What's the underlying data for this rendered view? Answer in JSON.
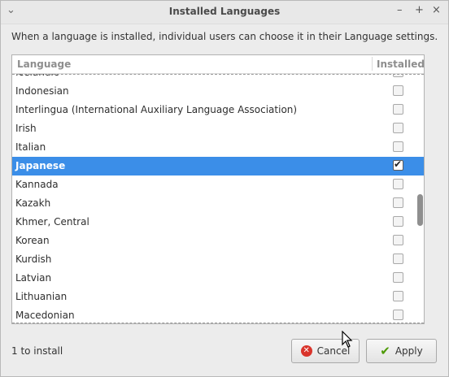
{
  "window": {
    "title": "Installed Languages",
    "description": "When a language is installed, individual users can choose it in their Language settings."
  },
  "list": {
    "header_language": "Language",
    "header_installed": "Installed",
    "rows": [
      {
        "label": "Icelandic",
        "installed": false,
        "selected": false
      },
      {
        "label": "Indonesian",
        "installed": false,
        "selected": false
      },
      {
        "label": "Interlingua (International Auxiliary Language Association)",
        "installed": false,
        "selected": false
      },
      {
        "label": "Irish",
        "installed": false,
        "selected": false
      },
      {
        "label": "Italian",
        "installed": false,
        "selected": false
      },
      {
        "label": "Japanese",
        "installed": true,
        "selected": true
      },
      {
        "label": "Kannada",
        "installed": false,
        "selected": false
      },
      {
        "label": "Kazakh",
        "installed": false,
        "selected": false
      },
      {
        "label": "Khmer, Central",
        "installed": false,
        "selected": false
      },
      {
        "label": "Korean",
        "installed": false,
        "selected": false
      },
      {
        "label": "Kurdish",
        "installed": false,
        "selected": false
      },
      {
        "label": "Latvian",
        "installed": false,
        "selected": false
      },
      {
        "label": "Lithuanian",
        "installed": false,
        "selected": false
      },
      {
        "label": "Macedonian",
        "installed": false,
        "selected": false
      }
    ]
  },
  "footer": {
    "status": "1 to install",
    "cancel_label": "Cancel",
    "apply_label": "Apply"
  },
  "titlebar_icons": {
    "menu": "window-menu-icon",
    "minimize": "minimize-icon",
    "maximize": "maximize-icon",
    "close": "close-icon"
  },
  "colors": {
    "selection": "#3b8ee8",
    "cancel_icon": "#d9342b",
    "apply_icon": "#4e9a06"
  }
}
